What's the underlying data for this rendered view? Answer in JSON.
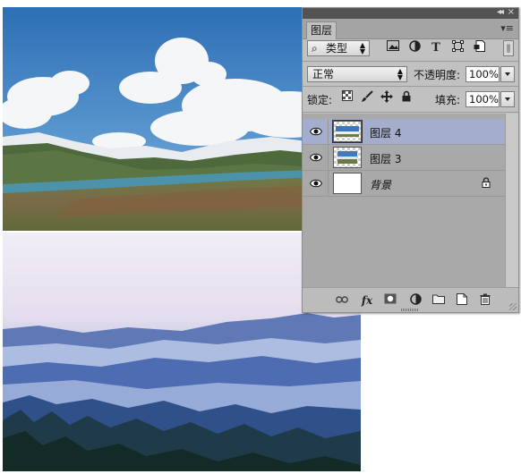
{
  "panel": {
    "collapse_glyph": "◂◂",
    "close_glyph": "×",
    "tab_label": "图层",
    "menu_glyph": "▾≡",
    "filter": {
      "search_glyph": "⌕",
      "kind_label": "类型",
      "icons": [
        "image-filter-icon",
        "adjustment-filter-icon",
        "type-filter-icon",
        "shape-filter-icon",
        "smart-object-filter-icon"
      ]
    },
    "blend_mode": "正常",
    "opacity_label": "不透明度:",
    "opacity_value": "100%",
    "lock_label": "锁定:",
    "fill_label": "填充:",
    "fill_value": "100%",
    "layers": [
      {
        "name": "图层 4",
        "selected": true,
        "italic": false,
        "locked": false,
        "thumb": "landscape"
      },
      {
        "name": "图层 3",
        "selected": false,
        "italic": false,
        "locked": false,
        "thumb": "landscape-small"
      },
      {
        "name": "背景",
        "selected": false,
        "italic": true,
        "locked": true,
        "thumb": "white"
      }
    ],
    "footer_icons": [
      "link-layers-icon",
      "fx-icon",
      "add-mask-icon",
      "adjustment-layer-icon",
      "group-folder-icon",
      "new-layer-icon",
      "trash-icon"
    ],
    "footer_fx_label": "fx"
  }
}
